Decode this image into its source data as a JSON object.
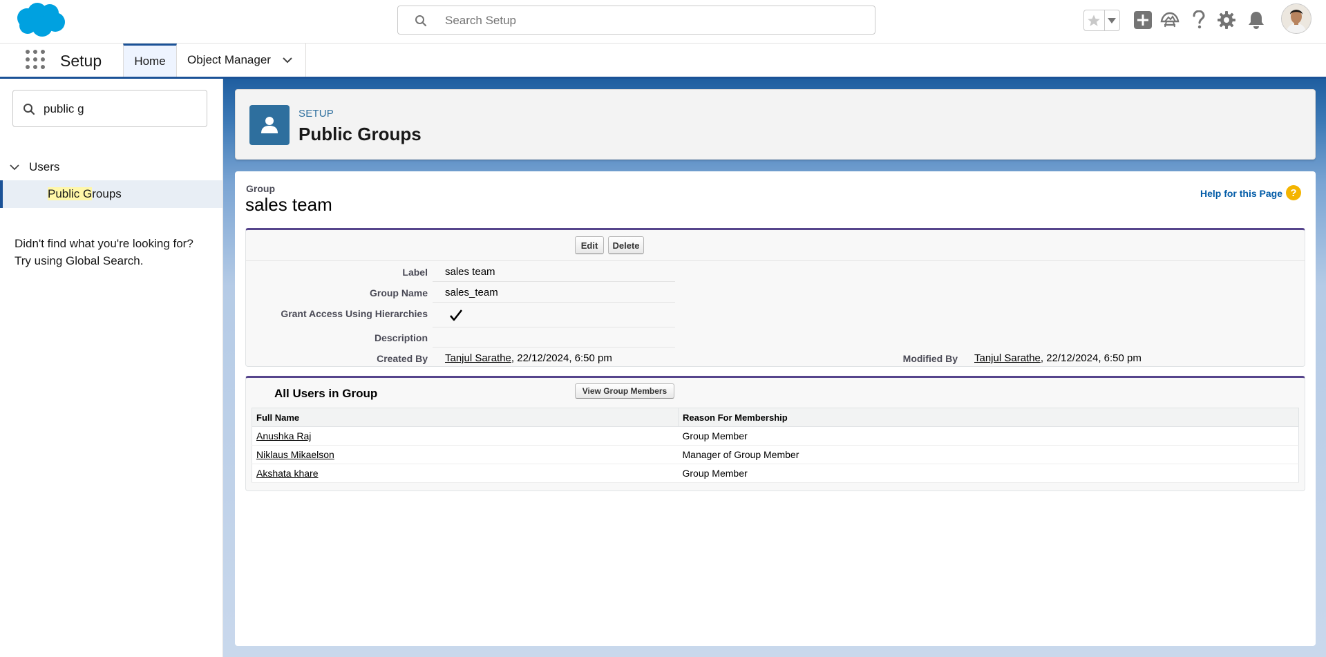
{
  "header": {
    "search_placeholder": "Search Setup"
  },
  "context_bar": {
    "app_name": "Setup",
    "tabs": [
      {
        "label": "Home"
      },
      {
        "label": "Object Manager"
      }
    ]
  },
  "sidebar": {
    "quickfind_value": "public g",
    "tree_parent": "Users",
    "tree_item_highlight": "Public G",
    "tree_item_rest": "roups",
    "not_found_line1": "Didn't find what you're looking for?",
    "not_found_line2": "Try using Global Search."
  },
  "page_header": {
    "kicker": "SETUP",
    "title": "Public Groups"
  },
  "group": {
    "kicker": "Group",
    "title": "sales team",
    "help_link": "Help for this Page",
    "help_icon_glyph": "?",
    "buttons": {
      "edit": "Edit",
      "delete": "Delete"
    },
    "fields": {
      "label_label": "Label",
      "label_value": "sales team",
      "group_name_label": "Group Name",
      "group_name_value": "sales_team",
      "grant_access_label": "Grant Access Using Hierarchies",
      "grant_access_checked": true,
      "description_label": "Description",
      "description_value": "",
      "created_by_label": "Created By",
      "created_by_user": "Tanjul Sarathe",
      "created_by_date": ", 22/12/2024, 6:50 pm",
      "modified_by_label": "Modified By",
      "modified_by_user": "Tanjul Sarathe",
      "modified_by_date": ", 22/12/2024, 6:50 pm"
    }
  },
  "members": {
    "title": "All Users in Group",
    "view_button": "View Group Members",
    "columns": [
      "Full Name",
      "Reason For Membership"
    ],
    "rows": [
      {
        "full_name": "Anushka Raj",
        "reason": "Group Member"
      },
      {
        "full_name": "Niklaus Mikaelson",
        "reason": "Manager of Group Member"
      },
      {
        "full_name": "Akshata khare",
        "reason": "Group Member"
      }
    ]
  },
  "colors": {
    "brand_blue": "#1b5297",
    "salesforce_cloud": "#00a1e0",
    "header_icon_gray": "#747474",
    "section_border": "#56458c",
    "link_blue": "#015ba7",
    "help_orange": "#f4b400"
  },
  "icons": [
    "salesforce-logo",
    "search-icon",
    "star-icon",
    "caret-down-icon",
    "plus-icon",
    "trailhead-icon",
    "question-icon",
    "gear-icon",
    "bell-icon",
    "app-launcher-icon",
    "chevron-down-icon",
    "user-icon",
    "checkmark-icon"
  ]
}
